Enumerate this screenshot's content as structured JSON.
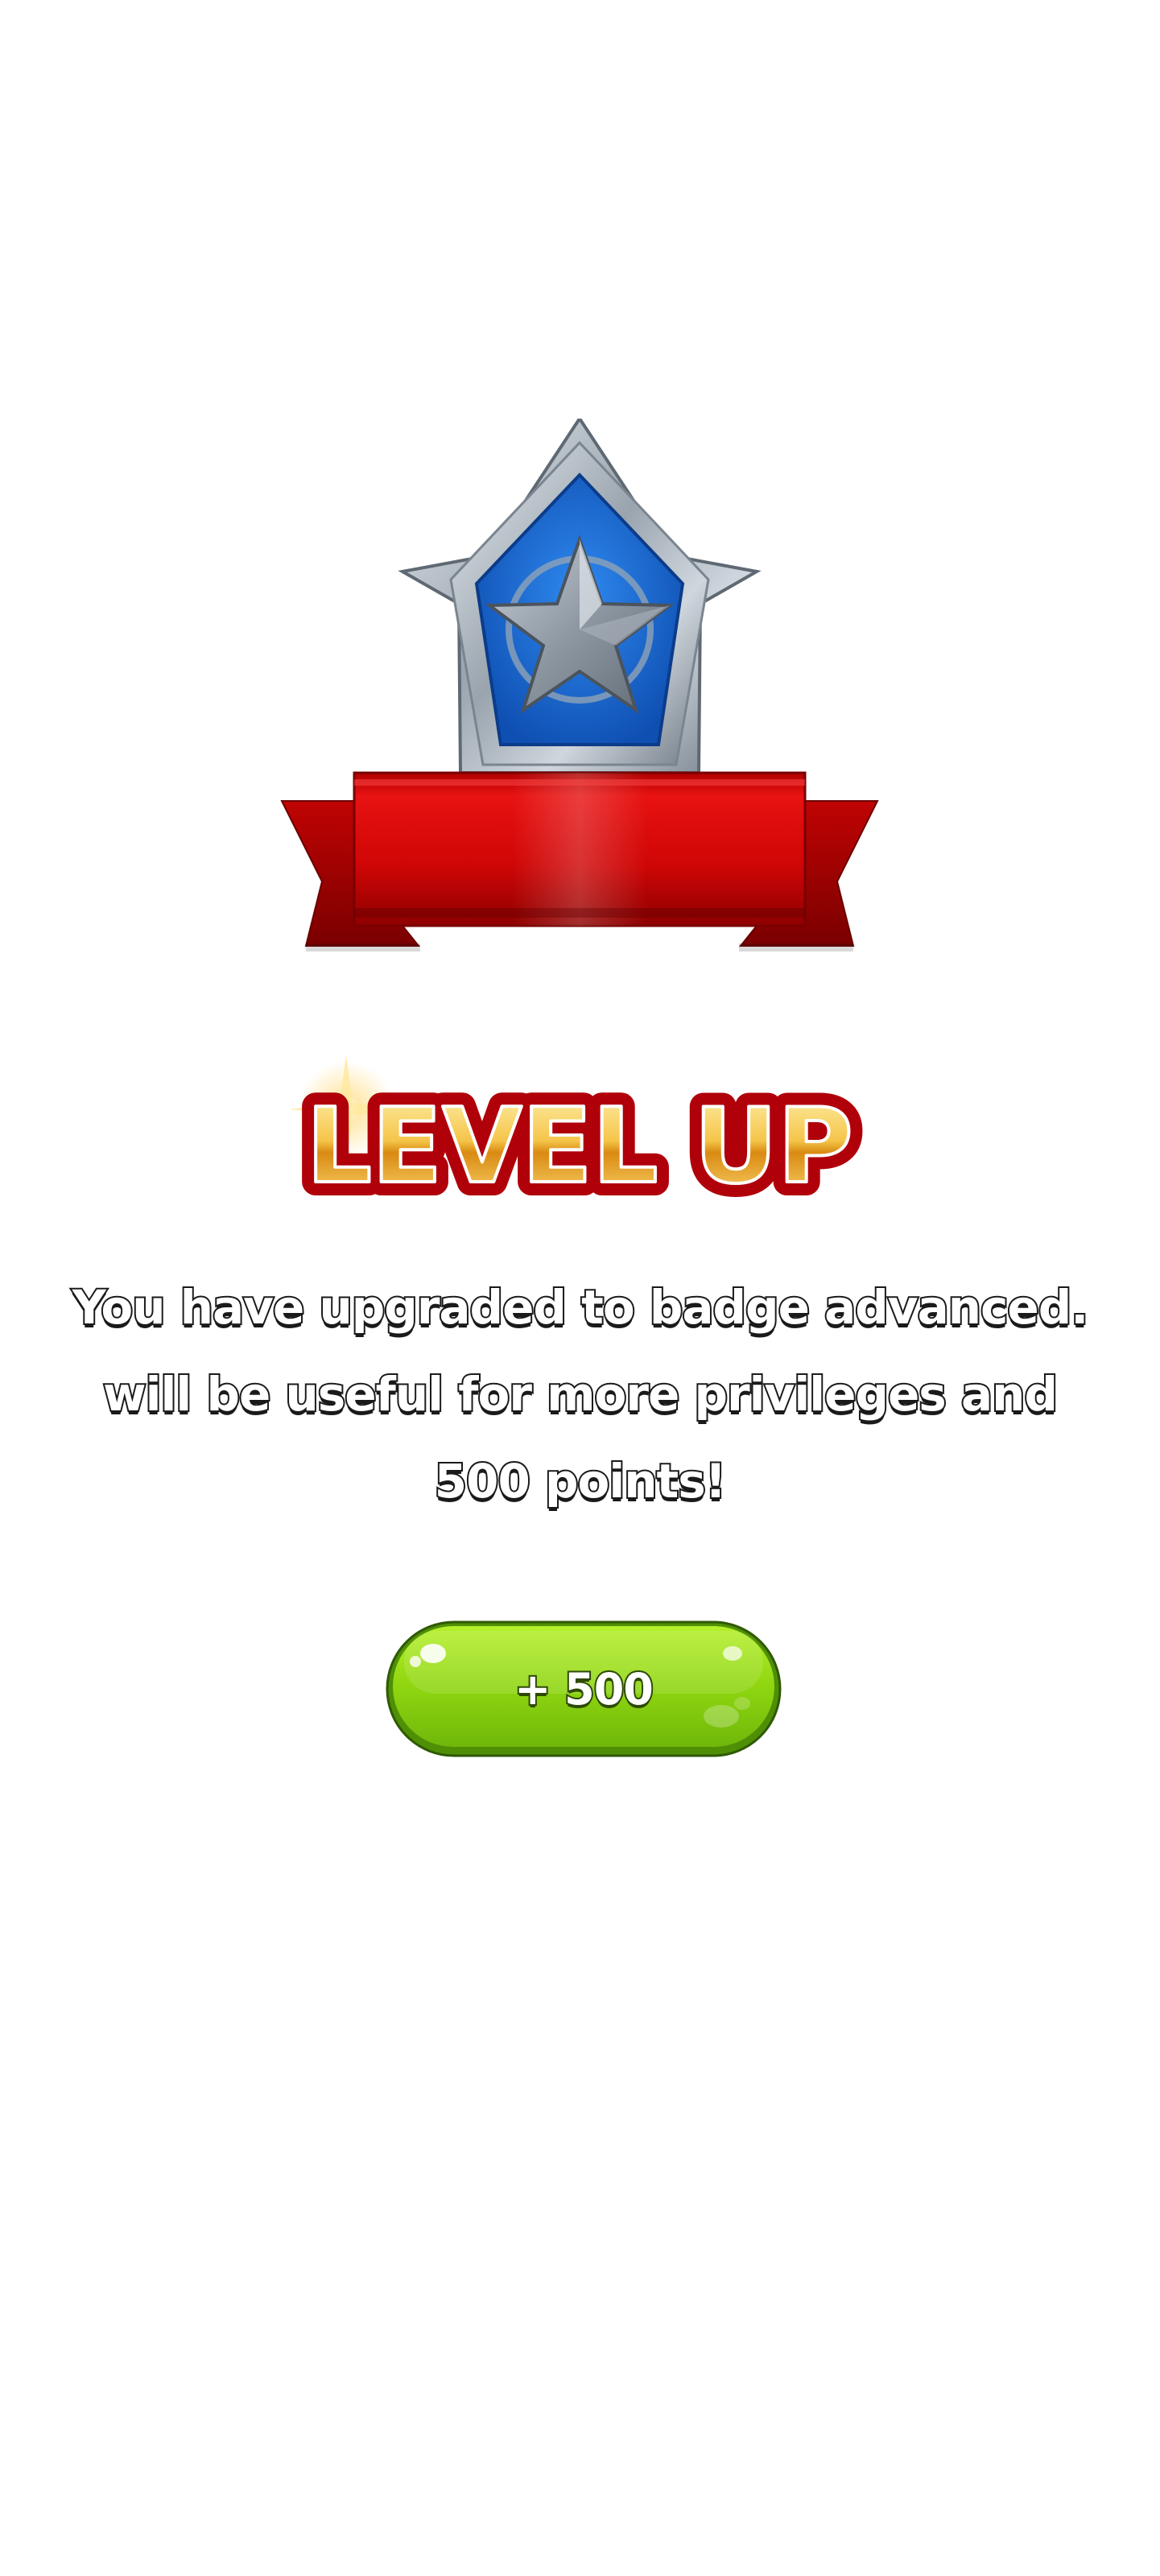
{
  "badge": {
    "icon": "star-badge-icon",
    "ribbon": "red-ribbon"
  },
  "title": {
    "text": "LEVEL UP"
  },
  "message": {
    "line1": "You have upgraded to badge advanced.",
    "line2": "will be useful for more privileges and",
    "line3": "500 points!"
  },
  "reward_button": {
    "label": "+ 500"
  },
  "colors": {
    "badge_blue": "#1d63c8",
    "ribbon_red": "#d90a0a",
    "title_gold": "#f2c24a",
    "title_red_outline": "#c8000a",
    "button_green": "#8fdc12"
  }
}
